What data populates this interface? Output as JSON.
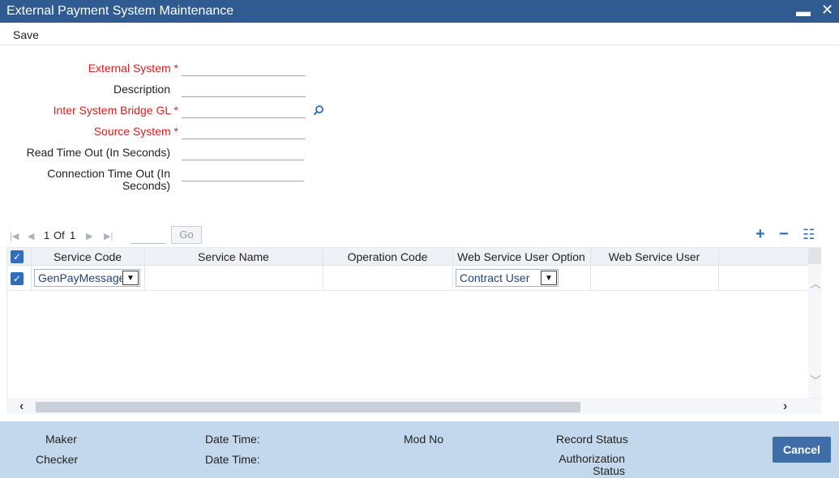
{
  "window": {
    "title": "External Payment System Maintenance",
    "minimize_glyph": "▬",
    "close_glyph": "✕"
  },
  "toolbar": {
    "save_label": "Save"
  },
  "form": {
    "external_system": {
      "label": "External System",
      "required_mark": "*",
      "value": ""
    },
    "description": {
      "label": "Description",
      "value": ""
    },
    "inter_system_bridge_gl": {
      "label": "Inter System Bridge GL",
      "required_mark": "*",
      "value": ""
    },
    "source_system": {
      "label": "Source System",
      "required_mark": "*",
      "value": ""
    },
    "read_timeout": {
      "label": "Read Time Out (In Seconds)",
      "value": ""
    },
    "connection_timeout": {
      "label_line1": "Connection Time Out (In",
      "label_line2": "Seconds)",
      "value": ""
    }
  },
  "pager": {
    "current": "1",
    "of_label": "Of",
    "total": "1",
    "page_input": "",
    "go_label": "Go"
  },
  "grid_actions": {
    "add": "+",
    "remove": "−",
    "columns": "☷"
  },
  "grid": {
    "columns": [
      "Service Code",
      "Service Name",
      "Operation Code",
      "Web Service User Option",
      "Web Service User"
    ],
    "rows": [
      {
        "service_code": "GenPayMessage",
        "service_name": "",
        "operation_code": "",
        "web_service_user_option": "Contract User",
        "web_service_user": ""
      }
    ]
  },
  "footer": {
    "maker": "Maker",
    "checker": "Checker",
    "date_time_1": "Date Time:",
    "date_time_2": "Date Time:",
    "mod_no": "Mod No",
    "record_status": "Record Status",
    "authorization_status_line1": "Authorization",
    "authorization_status_line2": "Status",
    "cancel_label": "Cancel"
  },
  "colors": {
    "title_bar": "#2f5b91",
    "required_label": "#d61f1f",
    "footer": "#c3d8ec",
    "cancel_button": "#3f6da7",
    "checkbox": "#2f6ebf"
  }
}
